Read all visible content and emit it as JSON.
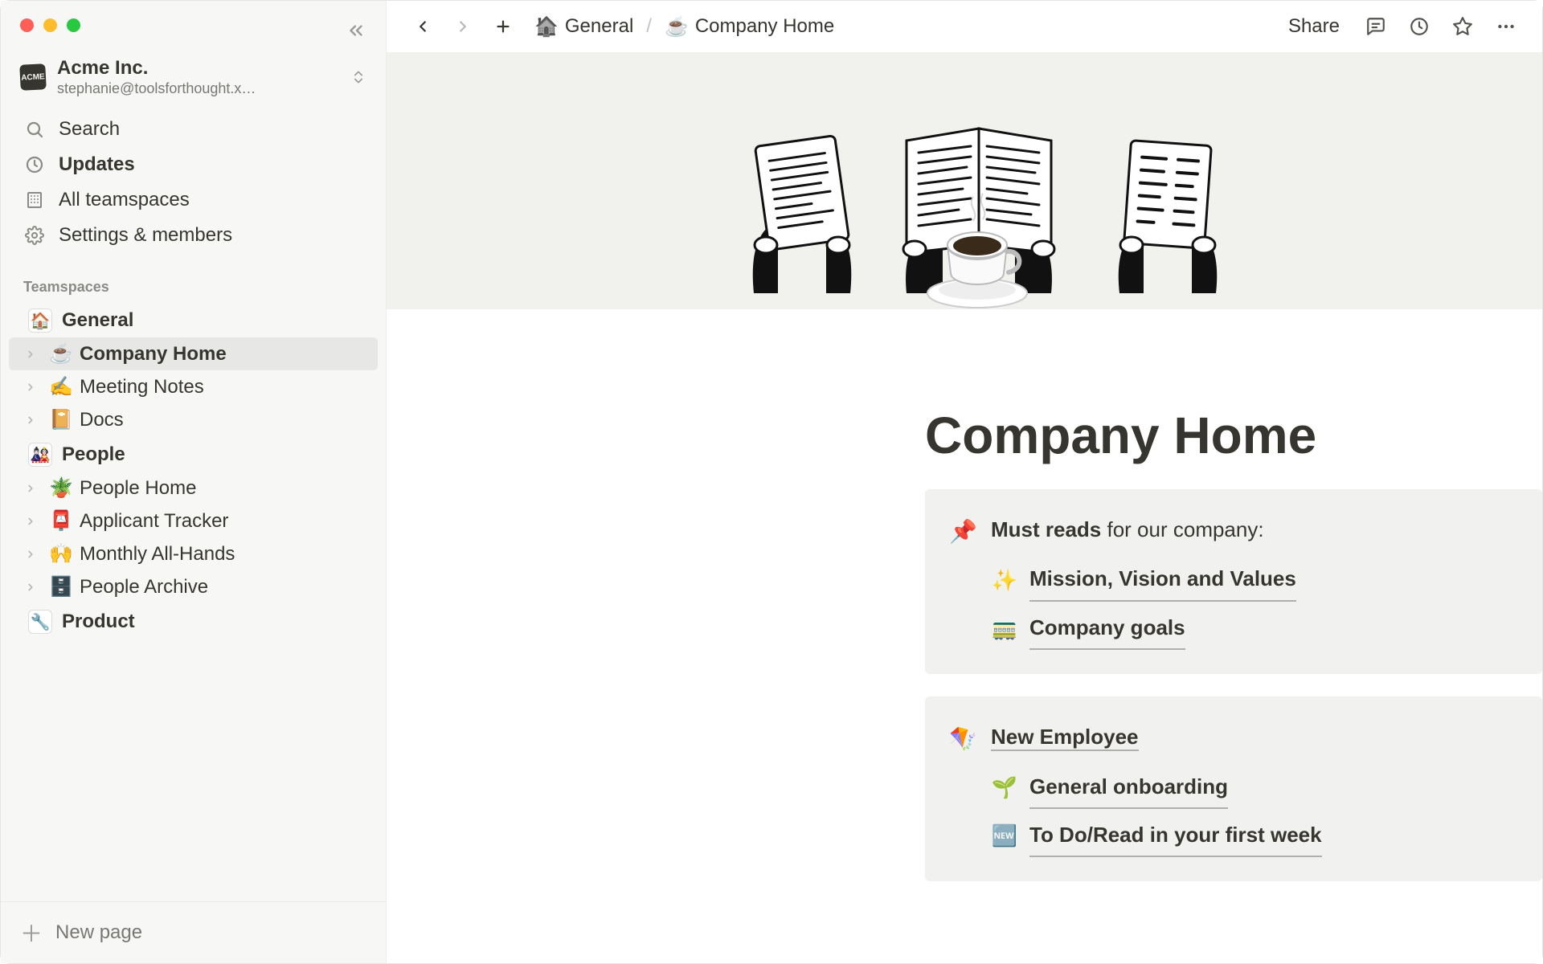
{
  "workspace": {
    "logo_text": "ACME",
    "name": "Acme Inc.",
    "email": "stephanie@toolsforthought.x…"
  },
  "nav": {
    "search": "Search",
    "updates": "Updates",
    "teamspaces": "All teamspaces",
    "settings": "Settings & members"
  },
  "section_teamspaces": "Teamspaces",
  "teamspaces": [
    {
      "emoji": "🏠",
      "name": "General",
      "children": [
        {
          "emoji": "☕",
          "label": "Company Home",
          "active": true
        },
        {
          "emoji": "✍️",
          "label": "Meeting Notes"
        },
        {
          "emoji": "📔",
          "label": "Docs"
        }
      ]
    },
    {
      "emoji": "🎎",
      "name": "People",
      "children": [
        {
          "emoji": "🪴",
          "label": "People Home"
        },
        {
          "emoji": "📮",
          "label": "Applicant Tracker"
        },
        {
          "emoji": "🙌",
          "label": "Monthly All-Hands"
        },
        {
          "emoji": "🗄️",
          "label": "People Archive"
        }
      ]
    },
    {
      "emoji": "🔧",
      "name": "Product",
      "children": []
    }
  ],
  "new_page": "New page",
  "topbar": {
    "share": "Share"
  },
  "breadcrumb": {
    "seg1_emoji": "🏠",
    "seg1": "General",
    "sep": "/",
    "seg2_emoji": "☕",
    "seg2": "Company Home"
  },
  "page": {
    "icon": "☕",
    "title": "Company Home"
  },
  "callouts": [
    {
      "emoji": "📌",
      "head_bold": "Must reads",
      "head_rest": " for our company:",
      "links": [
        {
          "emoji": "✨",
          "text": "Mission, Vision and Values"
        },
        {
          "emoji": "🚃",
          "text": "Company goals"
        }
      ]
    },
    {
      "emoji": "🪁",
      "title_link": "New Employee",
      "links": [
        {
          "emoji": "🌱",
          "text": "General onboarding"
        },
        {
          "emoji": "🆕",
          "text": "To Do/Read in your first week"
        }
      ]
    }
  ]
}
